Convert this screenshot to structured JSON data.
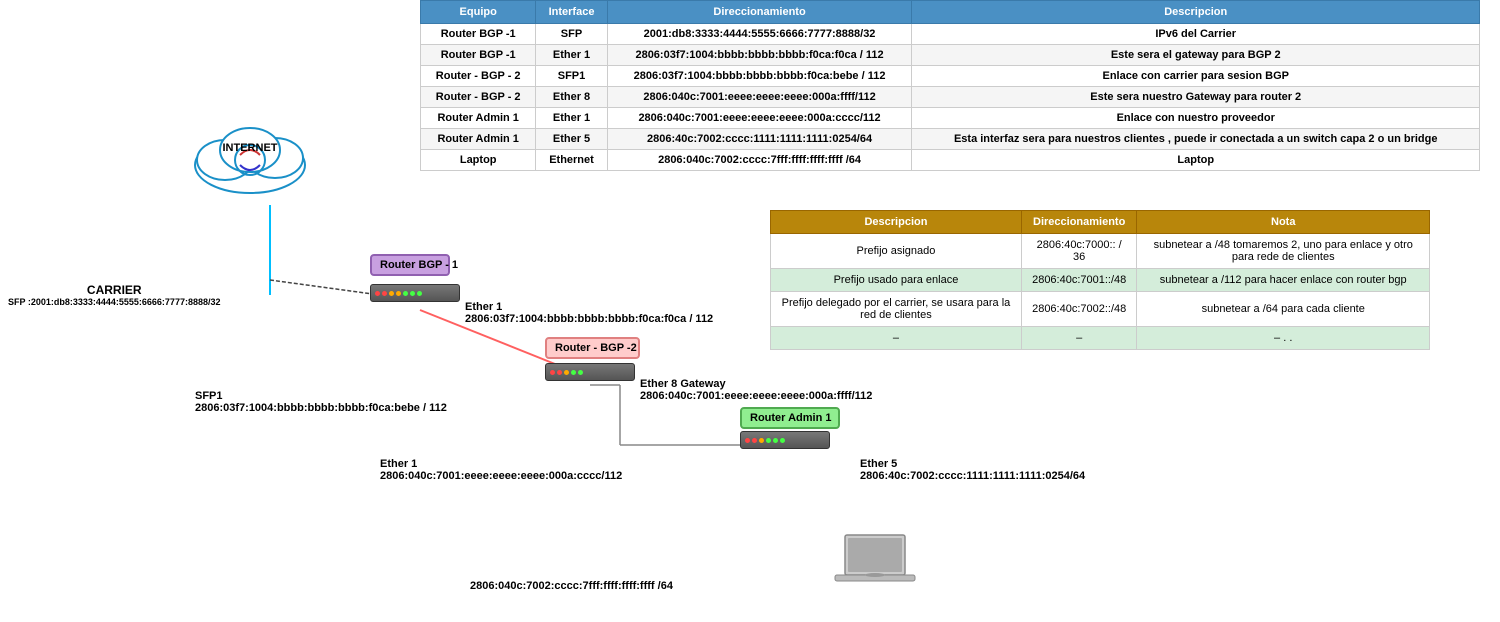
{
  "mainTable": {
    "headers": [
      "Equipo",
      "Interface",
      "Direccionamiento",
      "Descripcion"
    ],
    "rows": [
      [
        "Router BGP -1",
        "SFP",
        "2001:db8:3333:4444:5555:6666:7777:8888/32",
        "IPv6 del Carrier"
      ],
      [
        "Router BGP -1",
        "Ether 1",
        "2806:03f7:1004:bbbb:bbbb:bbbb:f0ca:f0ca / 112",
        "Este sera el gateway para BGP 2"
      ],
      [
        "Router - BGP - 2",
        "SFP1",
        "2806:03f7:1004:bbbb:bbbb:bbbb:f0ca:bebe / 112",
        "Enlace con carrier para sesion BGP"
      ],
      [
        "Router - BGP - 2",
        "Ether 8",
        "2806:040c:7001:eeee:eeee:eeee:000a:ffff/112",
        "Este sera nuestro Gateway para router 2"
      ],
      [
        "Router Admin 1",
        "Ether 1",
        "2806:040c:7001:eeee:eeee:eeee:000a:cccc/112",
        "Enlace con nuestro proveedor"
      ],
      [
        "Router Admin 1",
        "Ether 5",
        "2806:40c:7002:cccc:1111:1111:1111:0254/64",
        "Esta interfaz sera para nuestros clientes , puede ir conectada a un switch capa 2 o un bridge"
      ],
      [
        "Laptop",
        "Ethernet",
        "2806:040c:7002:cccc:7fff:ffff:ffff:ffff /64",
        "Laptop"
      ]
    ]
  },
  "secondTable": {
    "headers": [
      "Descripcion",
      "Direccionamiento",
      "Nota"
    ],
    "rows": [
      [
        "Prefijo asignado",
        "2806:40c:7000:: / 36",
        "subnetear a /48  tomaremos 2, uno para enlace y otro para rede de clientes"
      ],
      [
        "Prefijo usado para enlace",
        "2806:40c:7001::/48",
        "subnetear a /112 para hacer enlace con router bgp"
      ],
      [
        "Prefijo delegado por el carrier, se usara para la red de clientes",
        "2806:40c:7002::/48",
        "subnetear a /64 para cada cliente"
      ],
      [
        "–",
        "–",
        "– . ."
      ]
    ]
  },
  "diagram": {
    "internet": "INTERNET",
    "carrier": "CARRIER",
    "carrier_sfp": "SFP :2001:db8:3333:4444:5555:6666:7777:8888/32",
    "router_bgp1": "Router BGP -\n1",
    "router_bgp2": "Router - BGP -2",
    "router_admin1": "Router Admin 1",
    "ether1_bgp1_label": "Ether 1",
    "ether1_bgp1_addr": "2806:03f7:1004:bbbb:bbbb:bbbb:f0ca:f0ca / 112",
    "sfp1_bgp2_label": "SFP1",
    "sfp1_bgp2_addr": "2806:03f7:1004:bbbb:bbbb:bbbb:f0ca:bebe / 112",
    "ether8_label": "Ether 8 Gateway",
    "ether8_addr": "2806:040c:7001:eeee:eeee:eeee:000a:ffff/112",
    "ether1_admin1_label": "Ether 1",
    "ether1_admin1_addr": "2806:040c:7001:eeee:eeee:eeee:000a:cccc/112",
    "ether5_label": "Ether 5",
    "ether5_addr": "2806:40c:7002:cccc:1111:1111:1111:0254/64",
    "laptop_addr": "2806:040c:7002:cccc:7fff:ffff:ffff:ffff /64",
    "laptop_label": "Laptop"
  }
}
